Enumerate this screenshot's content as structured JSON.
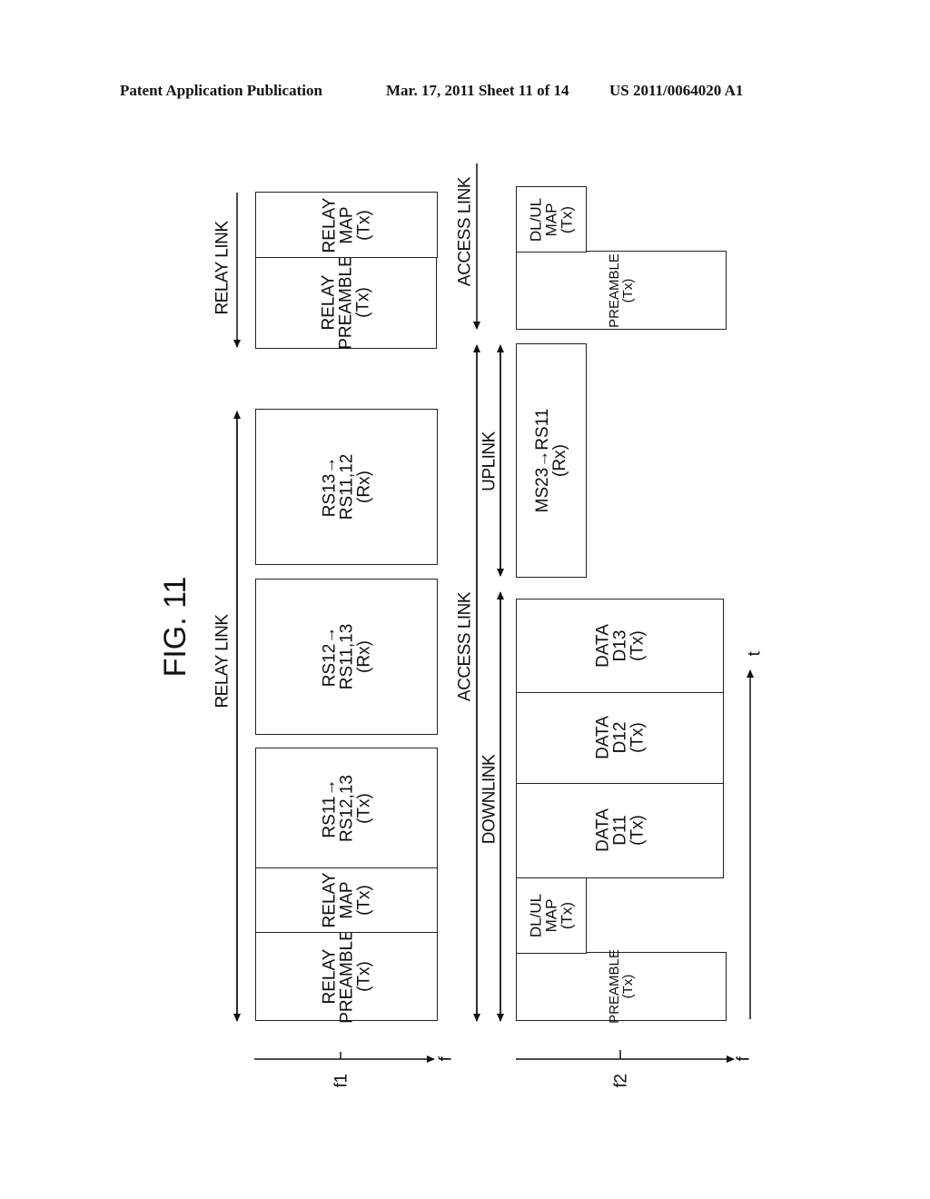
{
  "header": {
    "publication": "Patent Application Publication",
    "date_sheet": "Mar. 17, 2011  Sheet 11 of 14",
    "patent_number": "US 2011/0064020 A1"
  },
  "figure": {
    "title": "FIG. 11",
    "f1_band": {
      "frequency_label": "f1",
      "axis_label": "f",
      "relay_link_label_1": "RELAY LINK",
      "relay_link_label_2": "RELAY LINK",
      "blocks": [
        {
          "lines": [
            "RELAY",
            "PREAMBLE",
            "(Tx)"
          ]
        },
        {
          "lines": [
            "RELAY",
            "MAP",
            "(Tx)"
          ]
        },
        {
          "lines": [
            "RS11→",
            "RS12,13",
            "(Tx)"
          ]
        },
        {
          "lines": [
            "RS12→",
            "RS11,13",
            "(Rx)"
          ]
        },
        {
          "lines": [
            "RS13→",
            "RS11,12",
            "(Rx)"
          ]
        },
        {
          "lines": [
            "RELAY",
            "PREAMBLE",
            "(Tx)"
          ]
        },
        {
          "lines": [
            "RELAY",
            "MAP",
            "(Tx)"
          ]
        }
      ]
    },
    "f2_band": {
      "frequency_label": "f2",
      "axis_label": "f",
      "time_axis_label": "t",
      "access_link_label_1": "ACCESS LINK",
      "access_link_label_2": "ACCESS LINK",
      "downlink_label": "DOWNLINK",
      "uplink_label": "UPLINK",
      "blocks": [
        {
          "lines": [
            "PREAMBLE",
            "(Tx)"
          ]
        },
        {
          "lines": [
            "DL/UL",
            "MAP",
            "(Tx)"
          ]
        },
        {
          "lines": [
            "DATA",
            "D11",
            "(Tx)"
          ]
        },
        {
          "lines": [
            "DATA",
            "D12",
            "(Tx)"
          ]
        },
        {
          "lines": [
            "DATA",
            "D13",
            "(Tx)"
          ]
        },
        {
          "lines": [
            "MS23→RS11",
            "(Rx)"
          ]
        },
        {
          "lines": [
            "PREAMBLE",
            "(Tx)"
          ]
        },
        {
          "lines": [
            "DL/UL",
            "MAP",
            "(Tx)"
          ]
        }
      ]
    }
  }
}
